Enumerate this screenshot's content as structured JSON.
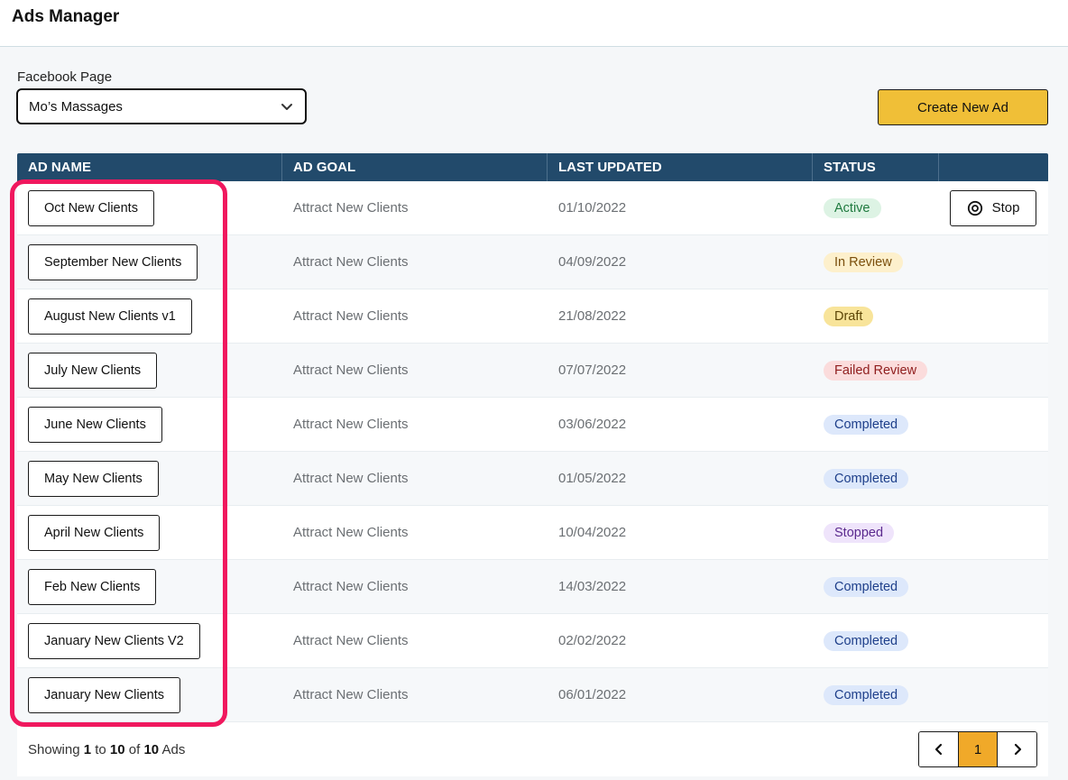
{
  "app": {
    "title": "Ads Manager"
  },
  "page_picker": {
    "label": "Facebook Page",
    "value": "Mo’s Massages"
  },
  "toolbar": {
    "create_label": "Create New Ad"
  },
  "table": {
    "headers": [
      "AD NAME",
      "AD GOAL",
      "LAST UPDATED",
      "STATUS",
      ""
    ],
    "stop_label": "Stop",
    "rows": [
      {
        "name": "Oct New Clients",
        "goal": "Attract New Clients",
        "updated": "01/10/2022",
        "status": "Active",
        "status_bg": "#ddf3e4",
        "status_fg": "#1f7a3f",
        "has_stop": true
      },
      {
        "name": "September New Clients",
        "goal": "Attract New Clients",
        "updated": "04/09/2022",
        "status": "In Review",
        "status_bg": "#fdf0cc",
        "status_fg": "#7a4e0c",
        "has_stop": false
      },
      {
        "name": "August New Clients v1",
        "goal": "Attract New Clients",
        "updated": "21/08/2022",
        "status": "Draft",
        "status_bg": "#f8e49a",
        "status_fg": "#5c4506",
        "has_stop": false
      },
      {
        "name": "July New Clients",
        "goal": "Attract New Clients",
        "updated": "07/07/2022",
        "status": "Failed Review",
        "status_bg": "#fbdcdc",
        "status_fg": "#8f1d1d",
        "has_stop": false
      },
      {
        "name": "June New Clients",
        "goal": "Attract New Clients",
        "updated": "03/06/2022",
        "status": "Completed",
        "status_bg": "#dde8fb",
        "status_fg": "#1e3f8a",
        "has_stop": false
      },
      {
        "name": "May New Clients",
        "goal": "Attract New Clients",
        "updated": "01/05/2022",
        "status": "Completed",
        "status_bg": "#dde8fb",
        "status_fg": "#1e3f8a",
        "has_stop": false
      },
      {
        "name": "April New Clients",
        "goal": "Attract New Clients",
        "updated": "10/04/2022",
        "status": "Stopped",
        "status_bg": "#efe4fb",
        "status_fg": "#5b2a8e",
        "has_stop": false
      },
      {
        "name": "Feb New Clients",
        "goal": "Attract New Clients",
        "updated": "14/03/2022",
        "status": "Completed",
        "status_bg": "#dde8fb",
        "status_fg": "#1e3f8a",
        "has_stop": false
      },
      {
        "name": "January New Clients V2",
        "goal": "Attract New Clients",
        "updated": "02/02/2022",
        "status": "Completed",
        "status_bg": "#dde8fb",
        "status_fg": "#1e3f8a",
        "has_stop": false
      },
      {
        "name": "January New Clients",
        "goal": "Attract New Clients",
        "updated": "06/01/2022",
        "status": "Completed",
        "status_bg": "#dde8fb",
        "status_fg": "#1e3f8a",
        "has_stop": false
      }
    ]
  },
  "footer": {
    "showing": "Showing",
    "from": "1",
    "to_word": "to",
    "to": "10",
    "of_word": "of",
    "total": "10",
    "unit": "Ads"
  },
  "pagination": {
    "current_page": "1",
    "prev_icon": "chevron-left-icon",
    "next_icon": "chevron-right-icon"
  },
  "colors": {
    "header_bg": "#224a6b",
    "accent": "#f0bf37",
    "highlight": "#f0185e"
  }
}
